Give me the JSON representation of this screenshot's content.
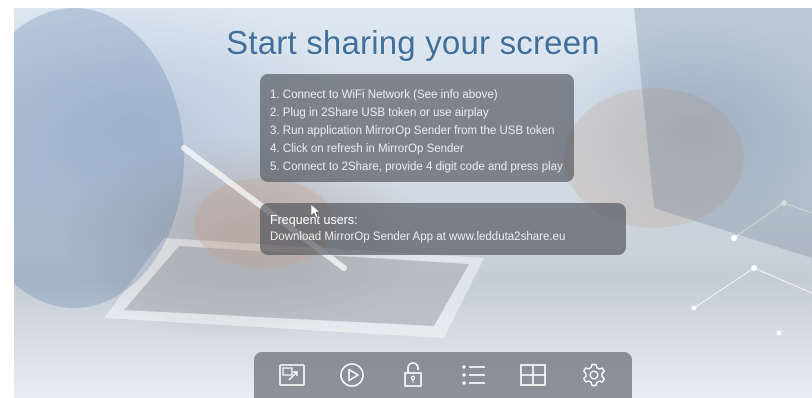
{
  "header": {
    "title": "Start sharing your screen"
  },
  "steps": [
    "1. Connect to WiFi Network (See info above)",
    "2. Plug in 2Share USB token or use airplay",
    "3. Run application MirrorOp Sender from the USB token",
    "4. Click on refresh in MirrorOp Sender",
    "5. Connect to 2Share, provide 4 digit code and press play"
  ],
  "frequent_users": {
    "heading": "Frequent users:",
    "text": "Download MirrorOp Sender App at www.ledduta2share.eu"
  },
  "toolbar": {
    "items": [
      {
        "icon": "screen-share-icon"
      },
      {
        "icon": "play-icon"
      },
      {
        "icon": "padlock-icon"
      },
      {
        "icon": "list-icon"
      },
      {
        "icon": "grid-icon"
      },
      {
        "icon": "gear-icon"
      }
    ]
  },
  "colors": {
    "title": "#3f6f9a",
    "panel": "#464a52"
  }
}
